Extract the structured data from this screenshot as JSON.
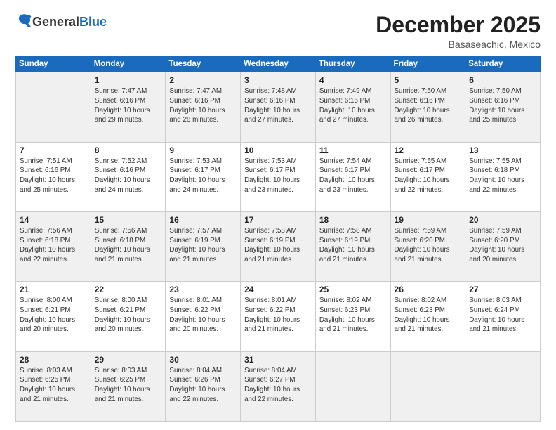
{
  "logo": {
    "general": "General",
    "blue": "Blue"
  },
  "header": {
    "month": "December 2025",
    "location": "Basaseachic, Mexico"
  },
  "weekdays": [
    "Sunday",
    "Monday",
    "Tuesday",
    "Wednesday",
    "Thursday",
    "Friday",
    "Saturday"
  ],
  "weeks": [
    [
      {
        "day": "",
        "info": ""
      },
      {
        "day": "1",
        "info": "Sunrise: 7:47 AM\nSunset: 6:16 PM\nDaylight: 10 hours\nand 29 minutes."
      },
      {
        "day": "2",
        "info": "Sunrise: 7:47 AM\nSunset: 6:16 PM\nDaylight: 10 hours\nand 28 minutes."
      },
      {
        "day": "3",
        "info": "Sunrise: 7:48 AM\nSunset: 6:16 PM\nDaylight: 10 hours\nand 27 minutes."
      },
      {
        "day": "4",
        "info": "Sunrise: 7:49 AM\nSunset: 6:16 PM\nDaylight: 10 hours\nand 27 minutes."
      },
      {
        "day": "5",
        "info": "Sunrise: 7:50 AM\nSunset: 6:16 PM\nDaylight: 10 hours\nand 26 minutes."
      },
      {
        "day": "6",
        "info": "Sunrise: 7:50 AM\nSunset: 6:16 PM\nDaylight: 10 hours\nand 25 minutes."
      }
    ],
    [
      {
        "day": "7",
        "info": "Sunrise: 7:51 AM\nSunset: 6:16 PM\nDaylight: 10 hours\nand 25 minutes."
      },
      {
        "day": "8",
        "info": "Sunrise: 7:52 AM\nSunset: 6:16 PM\nDaylight: 10 hours\nand 24 minutes."
      },
      {
        "day": "9",
        "info": "Sunrise: 7:53 AM\nSunset: 6:17 PM\nDaylight: 10 hours\nand 24 minutes."
      },
      {
        "day": "10",
        "info": "Sunrise: 7:53 AM\nSunset: 6:17 PM\nDaylight: 10 hours\nand 23 minutes."
      },
      {
        "day": "11",
        "info": "Sunrise: 7:54 AM\nSunset: 6:17 PM\nDaylight: 10 hours\nand 23 minutes."
      },
      {
        "day": "12",
        "info": "Sunrise: 7:55 AM\nSunset: 6:17 PM\nDaylight: 10 hours\nand 22 minutes."
      },
      {
        "day": "13",
        "info": "Sunrise: 7:55 AM\nSunset: 6:18 PM\nDaylight: 10 hours\nand 22 minutes."
      }
    ],
    [
      {
        "day": "14",
        "info": "Sunrise: 7:56 AM\nSunset: 6:18 PM\nDaylight: 10 hours\nand 22 minutes."
      },
      {
        "day": "15",
        "info": "Sunrise: 7:56 AM\nSunset: 6:18 PM\nDaylight: 10 hours\nand 21 minutes."
      },
      {
        "day": "16",
        "info": "Sunrise: 7:57 AM\nSunset: 6:19 PM\nDaylight: 10 hours\nand 21 minutes."
      },
      {
        "day": "17",
        "info": "Sunrise: 7:58 AM\nSunset: 6:19 PM\nDaylight: 10 hours\nand 21 minutes."
      },
      {
        "day": "18",
        "info": "Sunrise: 7:58 AM\nSunset: 6:19 PM\nDaylight: 10 hours\nand 21 minutes."
      },
      {
        "day": "19",
        "info": "Sunrise: 7:59 AM\nSunset: 6:20 PM\nDaylight: 10 hours\nand 21 minutes."
      },
      {
        "day": "20",
        "info": "Sunrise: 7:59 AM\nSunset: 6:20 PM\nDaylight: 10 hours\nand 20 minutes."
      }
    ],
    [
      {
        "day": "21",
        "info": "Sunrise: 8:00 AM\nSunset: 6:21 PM\nDaylight: 10 hours\nand 20 minutes."
      },
      {
        "day": "22",
        "info": "Sunrise: 8:00 AM\nSunset: 6:21 PM\nDaylight: 10 hours\nand 20 minutes."
      },
      {
        "day": "23",
        "info": "Sunrise: 8:01 AM\nSunset: 6:22 PM\nDaylight: 10 hours\nand 20 minutes."
      },
      {
        "day": "24",
        "info": "Sunrise: 8:01 AM\nSunset: 6:22 PM\nDaylight: 10 hours\nand 21 minutes."
      },
      {
        "day": "25",
        "info": "Sunrise: 8:02 AM\nSunset: 6:23 PM\nDaylight: 10 hours\nand 21 minutes."
      },
      {
        "day": "26",
        "info": "Sunrise: 8:02 AM\nSunset: 6:23 PM\nDaylight: 10 hours\nand 21 minutes."
      },
      {
        "day": "27",
        "info": "Sunrise: 8:03 AM\nSunset: 6:24 PM\nDaylight: 10 hours\nand 21 minutes."
      }
    ],
    [
      {
        "day": "28",
        "info": "Sunrise: 8:03 AM\nSunset: 6:25 PM\nDaylight: 10 hours\nand 21 minutes."
      },
      {
        "day": "29",
        "info": "Sunrise: 8:03 AM\nSunset: 6:25 PM\nDaylight: 10 hours\nand 21 minutes."
      },
      {
        "day": "30",
        "info": "Sunrise: 8:04 AM\nSunset: 6:26 PM\nDaylight: 10 hours\nand 22 minutes."
      },
      {
        "day": "31",
        "info": "Sunrise: 8:04 AM\nSunset: 6:27 PM\nDaylight: 10 hours\nand 22 minutes."
      },
      {
        "day": "",
        "info": ""
      },
      {
        "day": "",
        "info": ""
      },
      {
        "day": "",
        "info": ""
      }
    ]
  ]
}
